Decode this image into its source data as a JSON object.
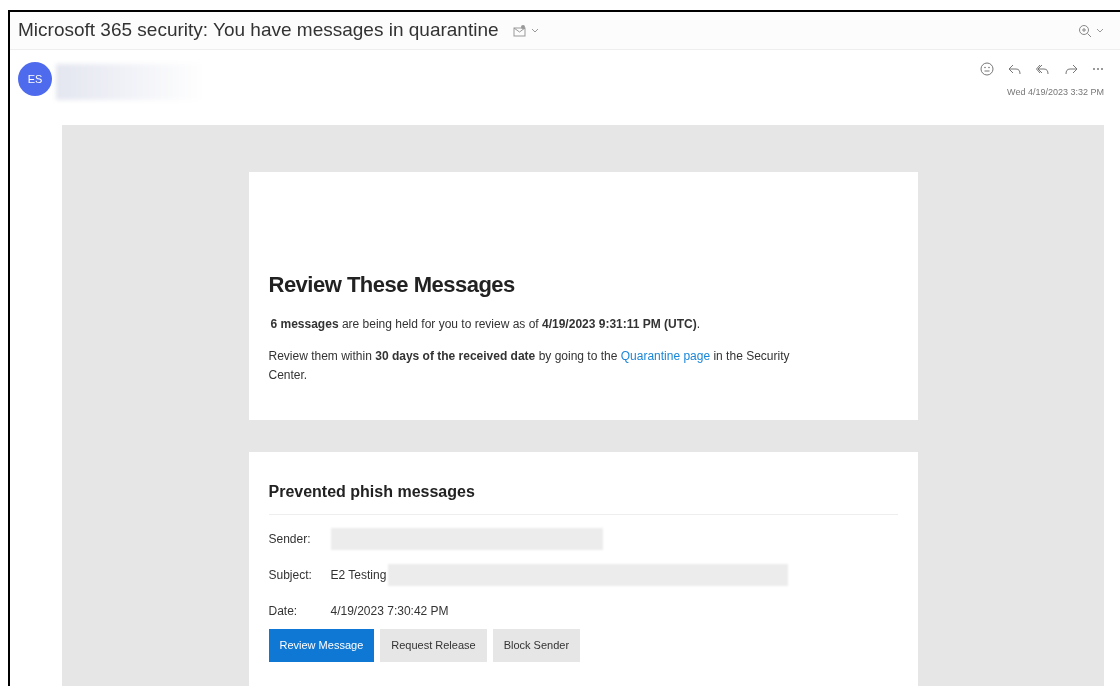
{
  "window": {
    "title": "Microsoft 365 security: You have messages in quarantine"
  },
  "header": {
    "avatar_initials": "ES",
    "timestamp": "Wed 4/19/2023 3:32 PM"
  },
  "summary": {
    "heading": "Review These Messages",
    "paragraphs": [
      "**6 messages** are being held for you to review as of **4/19/2023 9:31:11 PM (UTC)**.",
      "Review them within **30 days of the received date** by going to the "
    ],
    "link": "Quarantine page",
    "after_link": " in the Security Center."
  },
  "message_card": {
    "heading": "Prevented phish messages",
    "fields": [
      {
        "label": "Sender:",
        "redacted": true
      },
      {
        "label": "Subject:",
        "value": "E2 Testing",
        "redacted": true
      },
      {
        "label": "Date:",
        "value": "4/19/2023 7:30:42 PM",
        "redacted": false
      }
    ],
    "buttons": [
      {
        "label": "Review Message",
        "kind": "primary"
      },
      {
        "label": "Request Release",
        "kind": "secondary"
      },
      {
        "label": "Block Sender",
        "kind": "secondary"
      }
    ]
  }
}
